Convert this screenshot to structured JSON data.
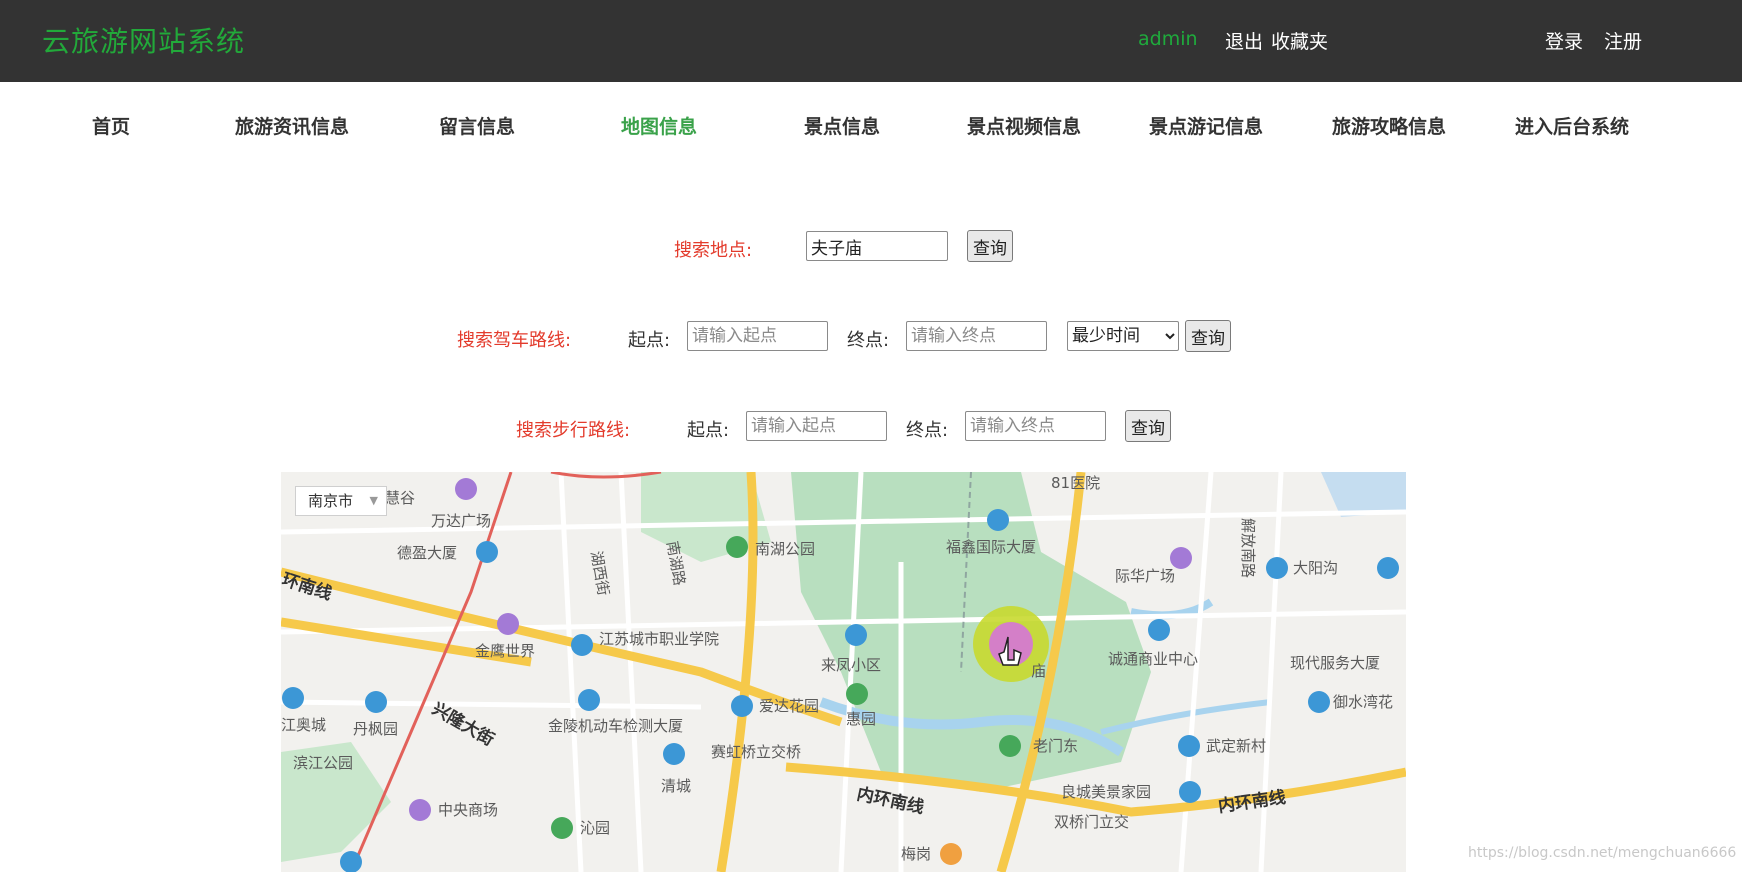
{
  "header": {
    "site_title": "云旅游网站系统",
    "user": "admin",
    "logout": "退出",
    "favorites": "收藏夹",
    "login": "登录",
    "register": "注册"
  },
  "nav": {
    "items": [
      {
        "label": "首页"
      },
      {
        "label": "旅游资讯信息"
      },
      {
        "label": "留言信息"
      },
      {
        "label": "地图信息",
        "active": true
      },
      {
        "label": "景点信息"
      },
      {
        "label": "景点视频信息"
      },
      {
        "label": "景点游记信息"
      },
      {
        "label": "旅游攻略信息"
      },
      {
        "label": "进入后台系统"
      }
    ]
  },
  "search_place": {
    "label": "搜索地点:",
    "value": "夫子庙",
    "button": "查询"
  },
  "drive_route": {
    "label": "搜索驾车路线:",
    "start_label": "起点:",
    "start_placeholder": "请输入起点",
    "end_label": "终点:",
    "end_placeholder": "请输入终点",
    "strategy": "最少时间",
    "button": "查询"
  },
  "walk_route": {
    "label": "搜索步行路线:",
    "start_label": "起点:",
    "start_placeholder": "请输入起点",
    "end_label": "终点:",
    "end_placeholder": "请输入终点",
    "button": "查询"
  },
  "map": {
    "city": "南京市",
    "labels": {
      "huigu": "慧谷",
      "wanda": "万达广场",
      "deying": "德盈大厦",
      "huannan": "环南线",
      "jinying": "金鹰世界",
      "hexijie": "湖西街",
      "nanhulu": "南湖路",
      "nanhu_park": "南湖公园",
      "jiangsu_college": "江苏城市职业学院",
      "laifeng": "来凤小区",
      "aida": "爱达花园",
      "huiyuan": "惠园",
      "jinling": "金陵机动车检测大厦",
      "danfeng": "丹枫园",
      "xinglong": "兴隆大街",
      "aoticheng": "江奥城",
      "binjiang": "滨江公园",
      "zhongyang": "中央商场",
      "qinyuan": "沁园",
      "qingcheng": "清城",
      "saihong": "赛虹桥立交桥",
      "neihuan1": "内环南线",
      "neihuan2": "内环南线",
      "meigang": "梅岗",
      "hospital": "81医院",
      "fuxin": "福鑫国际大厦",
      "jiefang": "解放南路",
      "jiti": "际华广场",
      "dayang": "大阳沟",
      "chengtong": "诚通商业中心",
      "xiandai": "现代服务大厦",
      "yushui": "御水湾花",
      "wuding": "武定新村",
      "laomendong": "老门东",
      "liangcheng": "良城美景家园",
      "shuangqiao": "双桥门立交",
      "fuzimiao": "庙"
    }
  },
  "watermark": "https://blog.csdn.net/mengchuan6666"
}
